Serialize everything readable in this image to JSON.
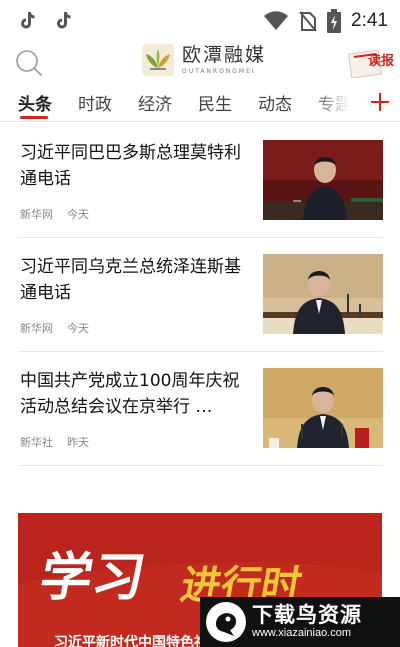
{
  "status_bar": {
    "time": "2:41",
    "icons": [
      "tiktok-icon",
      "tiktok-icon",
      "wifi-icon",
      "no-sim-icon",
      "battery-icon"
    ]
  },
  "header": {
    "logo_cn": "欧潭融媒",
    "logo_en": "OUTANRONGMEI",
    "read_paper_label": "读报",
    "search_icon": "search-icon",
    "accent_color": "#c8281e"
  },
  "tabs": {
    "items": [
      {
        "label": "头条",
        "active": true
      },
      {
        "label": "时政",
        "active": false
      },
      {
        "label": "经济",
        "active": false
      },
      {
        "label": "民生",
        "active": false
      },
      {
        "label": "动态",
        "active": false
      },
      {
        "label": "专题",
        "active": false
      }
    ],
    "add_icon": "plus-icon"
  },
  "news": [
    {
      "title": "习近平同巴巴多斯总理莫特利通电话",
      "source": "新华网",
      "time": "今天"
    },
    {
      "title": "习近平同乌克兰总统泽连斯基通电话",
      "source": "新华网",
      "time": "今天"
    },
    {
      "title": "中国共产党成立100周年庆祝活动总结会议在京举行 …",
      "source": "新华社",
      "time": "昨天"
    }
  ],
  "banner": {
    "title_part1": "学习",
    "title_part2": "进行时",
    "subtitle": "习近平新时代中国特色社会主义思想"
  },
  "watermark": {
    "name": "下载鸟资源",
    "url": "www.xiazainiao.com"
  }
}
